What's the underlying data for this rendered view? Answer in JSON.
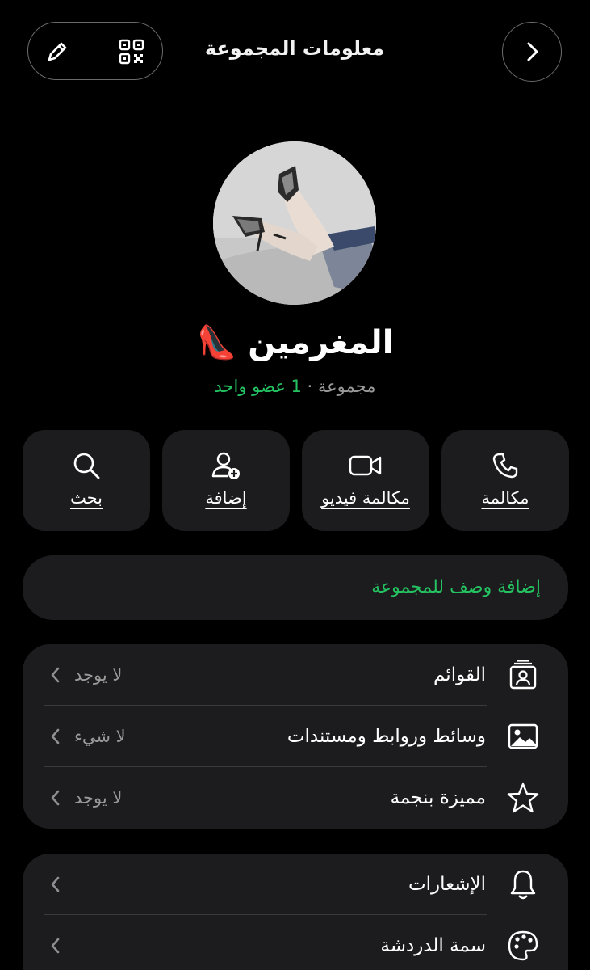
{
  "header": {
    "title": "معلومات المجموعة",
    "edit_icon": "pencil-icon",
    "qr_icon": "qr-code-icon",
    "back_icon": "chevron-right-icon"
  },
  "profile": {
    "name": "المغرمين 👠",
    "type": "مجموعة",
    "separator": "·",
    "members": "1 عضو واحد"
  },
  "actions": [
    {
      "label": "مكالمة",
      "icon": "phone-icon"
    },
    {
      "label": "مكالمة فيديو",
      "icon": "video-camera-icon"
    },
    {
      "label": "إضافة",
      "icon": "add-person-icon"
    },
    {
      "label": "بحث",
      "icon": "search-icon"
    }
  ],
  "description": {
    "label": "إضافة وصف للمجموعة"
  },
  "card1": [
    {
      "label": "القوائم",
      "value": "لا يوجد",
      "icon": "lists-icon"
    },
    {
      "label": "وسائط وروابط ومستندات",
      "value": "لا شيء",
      "icon": "image-icon"
    },
    {
      "label": "مميزة بنجمة",
      "value": "لا يوجد",
      "icon": "star-icon"
    }
  ],
  "card2": [
    {
      "label": "الإشعارات",
      "icon": "bell-icon"
    },
    {
      "label": "سمة الدردشة",
      "icon": "palette-icon"
    }
  ],
  "colors": {
    "background": "#000000",
    "surface": "#1c1c1e",
    "accent_green": "#25c261",
    "muted_text": "#9a9a9a"
  }
}
